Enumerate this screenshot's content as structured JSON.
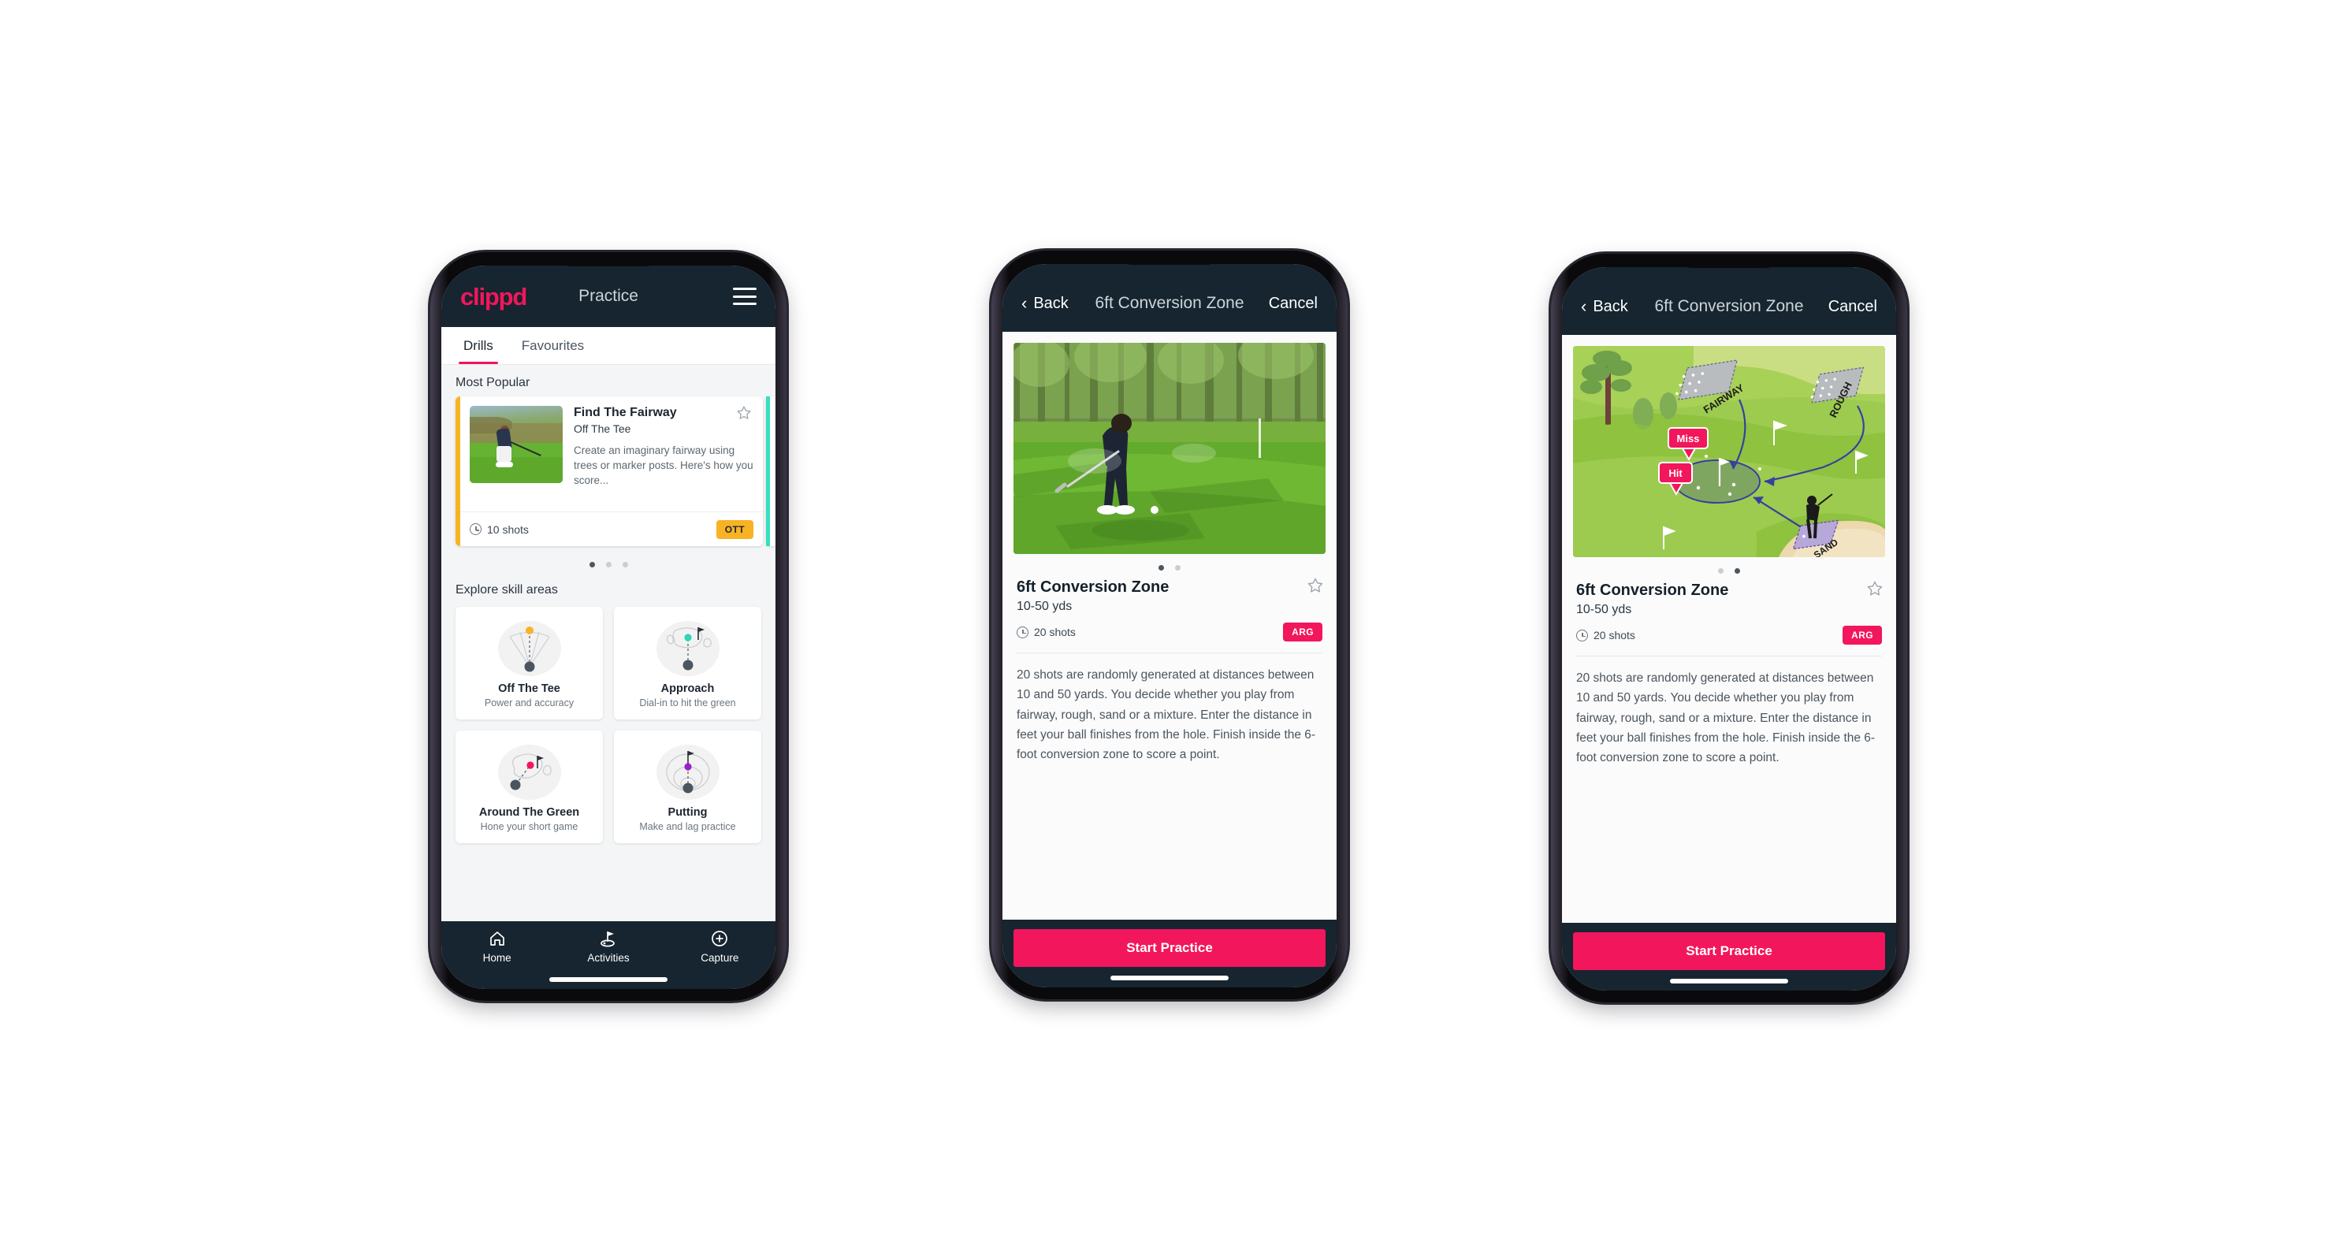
{
  "phones": [
    {
      "id": "practice-list",
      "appbar": {
        "logo": "clippd",
        "title": "Practice",
        "menu_icon": "hamburger-icon"
      },
      "tabs": [
        {
          "label": "Drills",
          "active": true
        },
        {
          "label": "Favourites",
          "active": false
        }
      ],
      "sections": {
        "most_popular_title": "Most Popular",
        "explore_title": "Explore skill areas"
      },
      "drill_card": {
        "name": "Find The Fairway",
        "category": "Off The Tee",
        "description": "Create an imaginary fairway using trees or marker posts. Here's how you score...",
        "shots": "10 shots",
        "badge": "OTT",
        "badge_color": "#f8b324",
        "accent_color": "#f8b324",
        "next_card_accent": "#35e0bf",
        "star_icon": "star-outline-icon",
        "clock_icon": "clock-icon"
      },
      "carousel_dots": {
        "count": 3,
        "active_index": 0
      },
      "skills": [
        {
          "name": "Off The Tee",
          "desc": "Power and accuracy",
          "icon": "tee-fan-icon",
          "dot_color": "#f8b324"
        },
        {
          "name": "Approach",
          "desc": "Dial-in to hit the green",
          "icon": "approach-green-icon",
          "dot_color": "#2fd6b4"
        },
        {
          "name": "Around The Green",
          "desc": "Hone your short game",
          "icon": "around-green-icon",
          "dot_color": "#f2165c"
        },
        {
          "name": "Putting",
          "desc": "Make and lag practice",
          "icon": "putting-rings-icon",
          "dot_color": "#9b1fc9"
        }
      ],
      "bottom_nav": [
        {
          "label": "Home",
          "icon": "home-icon",
          "active": false
        },
        {
          "label": "Activities",
          "icon": "golf-flag-icon",
          "active": true
        },
        {
          "label": "Capture",
          "icon": "plus-circle-icon",
          "active": false
        }
      ]
    },
    {
      "id": "drill-detail-photo",
      "appbar": {
        "back": "Back",
        "title": "6ft Conversion Zone",
        "cancel": "Cancel",
        "back_icon": "chevron-left-icon"
      },
      "hero": {
        "type": "photo",
        "alt": "golfer-chipping-photo"
      },
      "carousel_dots": {
        "count": 2,
        "active_index": 0
      },
      "detail": {
        "title": "6ft Conversion Zone",
        "distance": "10-50 yds",
        "shots": "20 shots",
        "badge": "ARG",
        "badge_color": "#f2165c",
        "star_icon": "star-outline-icon",
        "clock_icon": "clock-icon",
        "description": "20 shots are randomly generated at distances between 10 and 50 yards. You decide whether you play from fairway, rough, sand or a mixture. Enter the distance in feet your ball finishes from the hole. Finish inside the 6-foot conversion zone to score a point."
      },
      "cta": {
        "label": "Start Practice",
        "color": "#f2165c"
      }
    },
    {
      "id": "drill-detail-diagram",
      "appbar": {
        "back": "Back",
        "title": "6ft Conversion Zone",
        "cancel": "Cancel",
        "back_icon": "chevron-left-icon"
      },
      "hero": {
        "type": "diagram",
        "alt": "golf-course-diagram",
        "labels": [
          "FAIRWAY",
          "ROUGH",
          "SAND"
        ],
        "markers": [
          {
            "text": "Miss",
            "color": "#f2165c"
          },
          {
            "text": "Hit",
            "color": "#f2165c"
          }
        ]
      },
      "carousel_dots": {
        "count": 2,
        "active_index": 1
      },
      "detail": {
        "title": "6ft Conversion Zone",
        "distance": "10-50 yds",
        "shots": "20 shots",
        "badge": "ARG",
        "badge_color": "#f2165c",
        "star_icon": "star-outline-icon",
        "clock_icon": "clock-icon",
        "description": "20 shots are randomly generated at distances between 10 and 50 yards. You decide whether you play from fairway, rough, sand or a mixture. Enter the distance in feet your ball finishes from the hole. Finish inside the 6-foot conversion zone to score a point."
      },
      "cta": {
        "label": "Start Practice",
        "color": "#f2165c"
      }
    }
  ]
}
